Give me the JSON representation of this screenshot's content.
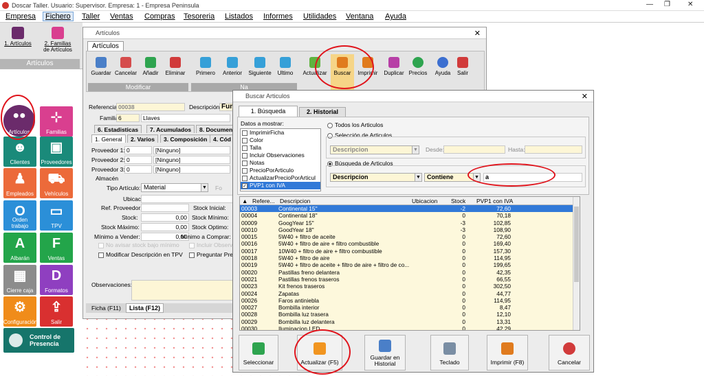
{
  "window": {
    "title": "Doscar Taller. Usuario: Supervisor. Empresa: 1 - Empresa Peninsula",
    "min": "—",
    "restore": "❐",
    "close": "✕"
  },
  "menu": [
    "Empresa",
    "Fichero",
    "Taller",
    "Ventas",
    "Compras",
    "Tesoreria",
    "Listados",
    "Informes",
    "Utilidades",
    "Ventana",
    "Ayuda"
  ],
  "ribbon": {
    "btn1": "1. Artículos",
    "btn2a": "2. Familias",
    "btn2b": "de Artículos",
    "group": "Artículos"
  },
  "tiles": [
    {
      "label": "Artículos",
      "color": "#6b2b6b",
      "icon": "circles-icon"
    },
    {
      "label": "Familias",
      "color": "#d93f8f",
      "icon": "org-icon"
    },
    {
      "label": "Clientes",
      "color": "#1a8a7a",
      "icon": "person-icon"
    },
    {
      "label": "Proveedores",
      "color": "#1a8a7a",
      "icon": "box-icon"
    },
    {
      "label": "Empleados",
      "color": "#ec6a3a",
      "icon": "worker-icon"
    },
    {
      "label": "Vehículos",
      "color": "#ec6a3a",
      "icon": "car-icon"
    },
    {
      "label": "Orden trabajo",
      "color": "#2b8fd8",
      "icon": "O"
    },
    {
      "label": "TPV",
      "color": "#2b8fd8",
      "icon": "monitor-icon"
    },
    {
      "label": "Albarán",
      "color": "#23a54a",
      "icon": "A"
    },
    {
      "label": "Ventas",
      "color": "#23a54a",
      "icon": "F"
    },
    {
      "label": "Cierre caja",
      "color": "#8c8c8c",
      "icon": "safe-icon"
    },
    {
      "label": "Formatos",
      "color": "#8f3fc0",
      "icon": "D"
    },
    {
      "label": "Configuración",
      "color": "#f08c1a",
      "icon": "gears-icon"
    },
    {
      "label": "Salir",
      "color": "#d93030",
      "icon": "exit-icon"
    }
  ],
  "control": {
    "line1": "Control de",
    "line2": "Presencia",
    "color": "#16756b"
  },
  "articulos": {
    "title": "Artículos",
    "tab": "Artículos",
    "buttons": [
      "Guardar",
      "Cancelar",
      "Añadir",
      "Eliminar",
      "Primero",
      "Anterior",
      "Siguiente",
      "Ultimo",
      "Actualizar",
      "Buscar",
      "Imprimir",
      "Duplicar",
      "Precios",
      "Ayuda",
      "Salir"
    ],
    "group_modificar": "Modificar",
    "group_nav": "Na",
    "referencia_label": "Referencia:",
    "referencia": "00038",
    "descripcion_label": "Descripción:",
    "descripcion": "Fun",
    "familia_label": "Familia:",
    "familia": "6",
    "familia_name": "Llaves",
    "tabs1": [
      "6. Estadisticas",
      "7. Acumulados",
      "8. Documen"
    ],
    "tabs2": [
      "1. General",
      "2. Varios",
      "3. Composición",
      "4. Cód"
    ],
    "prov_labels": [
      "Proveedor 1:",
      "Proveedor 2:",
      "Proveedor 3:"
    ],
    "prov_vals": [
      "0",
      "0",
      "0"
    ],
    "prov_names": [
      "[Ninguno]",
      "[Ninguno]",
      "[Ninguno]"
    ],
    "almacen": "Almacén",
    "tipo_label": "Tipo Artículo:",
    "tipo": "Material",
    "f_label": "Fo",
    "ubicacion": "Ubicación:",
    "ref_prov": "Ref. Proveedor:",
    "stock": "Stock:",
    "stock_val": "0,00",
    "stock_max": "Stock Máximo:",
    "stock_max_val": "0,00",
    "min_vender": "Mínimo a Vender:",
    "min_vender_val": "0,00",
    "stock_inicial": "Stock Inicial:",
    "stock_minimo": "Stock Mínimo:",
    "stock_optimo": "Stock Optimo:",
    "min_comprar": "Mínimo a Comprar:",
    "faded1": "No avisar stock bajo mínimo",
    "faded2": "Incluir Observ",
    "chk1": "Modificar Descripción en TPV",
    "chk2": "Preguntar Precio",
    "obs": "Observaciones:",
    "bottom_tabs": [
      "Ficha (F11)",
      "Lista (F12)"
    ]
  },
  "buscar": {
    "title": "Buscar Articulos",
    "tabs": [
      "1. Búsqueda",
      "2. Historial"
    ],
    "datos_label": "Datos a mostrar:",
    "datos": [
      {
        "t": "ImprimirFicha",
        "c": false
      },
      {
        "t": "Color",
        "c": false
      },
      {
        "t": "Talla",
        "c": false
      },
      {
        "t": "Incluir Observaciones",
        "c": false
      },
      {
        "t": "Notas",
        "c": false
      },
      {
        "t": "PrecioPorArticulo",
        "c": false
      },
      {
        "t": "ActualizarPrecioPorArticul",
        "c": false
      },
      {
        "t": "PVP1 con IVA",
        "c": true
      }
    ],
    "radio1": "Todos los Articulos",
    "radio2": "Selección de Articulos",
    "sel_field": "Descripcion",
    "desde": "Desde:",
    "hasta": "Hasta:",
    "radio3": "Búsqueda de Articulos",
    "campo": "Descripcion",
    "modo": "Contiene",
    "valor": "a",
    "headers": [
      "Refere...",
      "Descripcion",
      "Ubicacion",
      "Stock",
      "PVP1 con IVA"
    ],
    "rows": [
      [
        "00003",
        "Continental 15''",
        "",
        "-2",
        "72,60"
      ],
      [
        "00004",
        "Continental 18''",
        "",
        "0",
        "70,18"
      ],
      [
        "00009",
        "GoogYear 15''",
        "",
        "-3",
        "102,85"
      ],
      [
        "00010",
        "GoodYear 18''",
        "",
        "-3",
        "108,90"
      ],
      [
        "00015",
        "5W40 + filtro de aceite",
        "",
        "0",
        "72,60"
      ],
      [
        "00016",
        "5W40 + filtro de aire + filtro combustible",
        "",
        "0",
        "169,40"
      ],
      [
        "00017",
        "10W40 + filtro de aire + filtro combustible",
        "",
        "0",
        "157,30"
      ],
      [
        "00018",
        "5W40 + filtro de aire",
        "",
        "0",
        "114,95"
      ],
      [
        "00019",
        "5W40 + filtro de aceite + filtro de aire + filtro de co...",
        "",
        "0",
        "199,65"
      ],
      [
        "00020",
        "Pastillas freno delantera",
        "",
        "0",
        "42,35"
      ],
      [
        "00021",
        "Pastillas frenos traseros",
        "",
        "0",
        "66,55"
      ],
      [
        "00023",
        "Kit frenos traseros",
        "",
        "0",
        "302,50"
      ],
      [
        "00024",
        "Zapatas",
        "",
        "0",
        "44,77"
      ],
      [
        "00026",
        "Faros antiniebla",
        "",
        "0",
        "114,95"
      ],
      [
        "00027",
        "Bombilla interior",
        "",
        "0",
        "8,47"
      ],
      [
        "00028",
        "Bombilla luz trasera",
        "",
        "0",
        "12,10"
      ],
      [
        "00029",
        "Bombilla luz delantera",
        "",
        "0",
        "13,31"
      ],
      [
        "00030",
        "Iluminacion LED",
        "",
        "0",
        "42,29"
      ]
    ],
    "bottom": [
      "Seleccionar",
      "Actualizar (F5)",
      "Guardar en Historial",
      "Teclado",
      "Imprimir (F8)",
      "Cancelar"
    ]
  }
}
